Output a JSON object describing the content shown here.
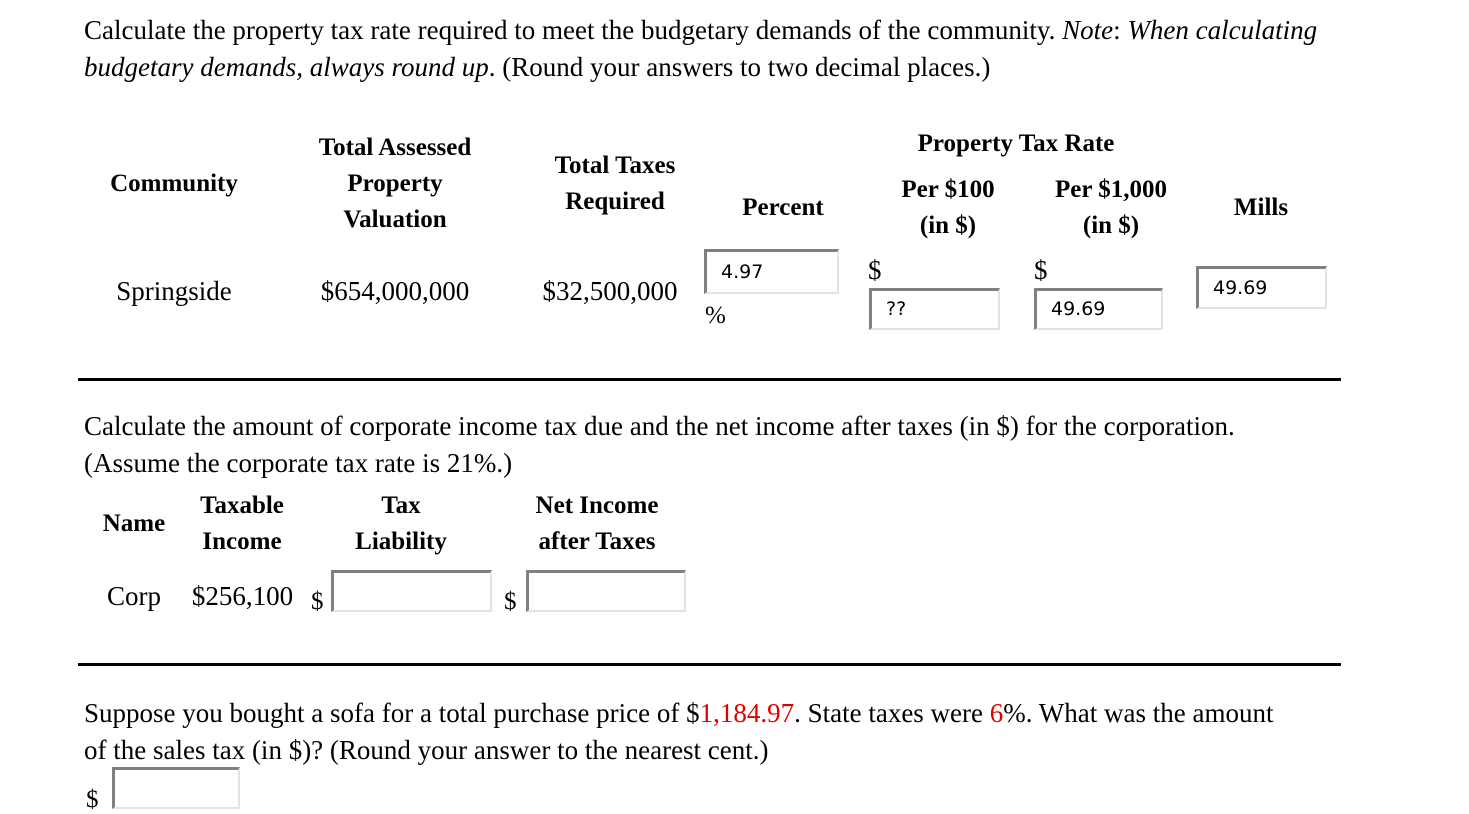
{
  "problem1": {
    "prompt_part1": "Calculate the property tax rate required to meet the budgetary demands of the community. ",
    "prompt_note_label": "Note",
    "prompt_colon": ": ",
    "prompt_note_italic": "When calculating budgetary demands, always round up",
    "prompt_part2": ". (Round your answers to two decimal places.)",
    "headers": {
      "community": "Community",
      "total_assessed_property_valuation": "Total Assessed\nProperty\nValuation",
      "total_assessed_line1": "Total Assessed",
      "total_assessed_line2": "Property",
      "total_assessed_line3": "Valuation",
      "total_taxes_line1": "Total Taxes",
      "total_taxes_line2": "Required",
      "percent": "Percent",
      "property_tax_rate": "Property Tax Rate",
      "per_100_line1": "Per $100",
      "per_100_line2": "(in $)",
      "per_1000_line1": "Per $1,000",
      "per_1000_line2": "(in $)",
      "mills": "Mills"
    },
    "row": {
      "community": "Springside",
      "total_assessed_valuation": "$654,000,000",
      "total_taxes_required": "$32,500,000",
      "percent_value": "4.97",
      "percent_sign": "%",
      "per_100_dollar_sign": "$",
      "per_100_value": "??",
      "per_1000_dollar_sign": "$",
      "per_1000_value": "49.69",
      "mills_value": "49.69"
    }
  },
  "problem2": {
    "prompt": "Calculate the amount of corporate income tax due and the net income after taxes (in $) for the corporation. (Assume the corporate tax rate is 21%.)",
    "headers": {
      "name": "Name",
      "taxable_income_line1": "Taxable",
      "taxable_income_line2": "Income",
      "tax_liability_line1": "Tax",
      "tax_liability_line2": "Liability",
      "net_income_line1": "Net Income",
      "net_income_line2": "after Taxes"
    },
    "row": {
      "name": "Corp",
      "taxable_income": "$256,100",
      "tax_liability_dollar_sign": "$",
      "tax_liability_value": "",
      "net_income_dollar_sign": "$",
      "net_income_value": ""
    }
  },
  "problem3": {
    "prompt_part1": "Suppose you bought a sofa for a total purchase price of $",
    "price_red": "1,184.97",
    "prompt_part2": ". State taxes were ",
    "rate_red": "6",
    "percent_sign": "%",
    "prompt_part3": ". What was the amount of the sales tax (in $)? (Round your answer to the nearest cent.)",
    "answer_dollar_sign": "$",
    "answer_value": ""
  },
  "colors": {
    "highlight_red": "#e00000",
    "text_black": "#000000",
    "box_border_dark": "#808080",
    "box_border_light": "#e3e3e3",
    "background": "#ffffff"
  }
}
